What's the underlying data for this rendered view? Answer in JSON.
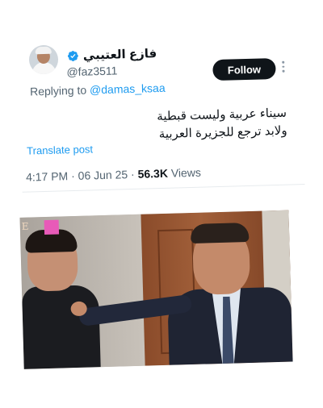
{
  "author": {
    "display_name": "فازع العتيبي",
    "handle": "@faz3511",
    "verified": true
  },
  "follow_label": "Follow",
  "replying": {
    "prefix": "Replying to ",
    "to": "@damas_ksaa"
  },
  "tweet": {
    "lines": [
      "سيناء عربية وليست قبطية",
      "ولابد ترجع للجزيرة العربية"
    ]
  },
  "translate_label": "Translate post",
  "meta": {
    "time": "4:17 PM",
    "sep": " · ",
    "date": "06 Jun 25",
    "sep2": " · ",
    "views_count": "56.3K",
    "views_label": " Views"
  },
  "media": {
    "corner_letter": "E"
  },
  "colors": {
    "link": "#1d9bf0",
    "button_bg": "#0f1419",
    "muted": "#536471",
    "verified": "#1d9bf0"
  },
  "icons": {
    "verified": "verified-badge-icon",
    "more": "more-icon"
  }
}
